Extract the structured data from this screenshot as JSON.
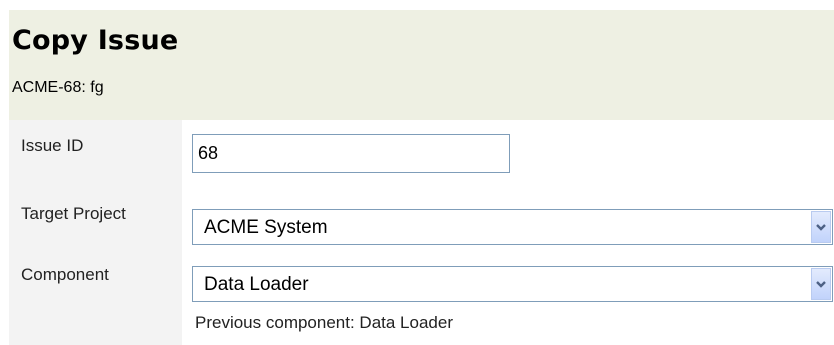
{
  "header": {
    "title": "Copy Issue",
    "subtitle": "ACME-68: fg"
  },
  "form": {
    "issue_id": {
      "label": "Issue ID",
      "value": "68"
    },
    "target_project": {
      "label": "Target Project",
      "value": "ACME System"
    },
    "component": {
      "label": "Component",
      "value": "Data Loader",
      "hint": "Previous component: Data Loader"
    }
  },
  "icons": {
    "dropdown": "chevron-down-icon"
  },
  "colors": {
    "header_bg": "#eef0e3",
    "label_bg": "#f3f3f3",
    "input_border": "#7f9db9",
    "arrow_fill": "#4d6185"
  }
}
